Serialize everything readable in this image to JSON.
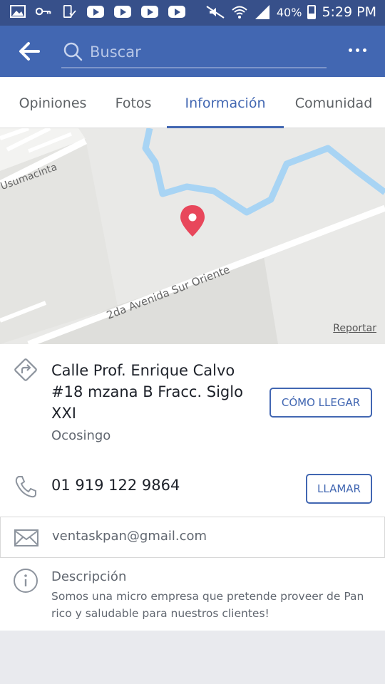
{
  "status_bar": {
    "battery": "40%",
    "time": "5:29 PM"
  },
  "header": {
    "search_placeholder": "Buscar"
  },
  "tabs": [
    {
      "label": "Opiniones",
      "active": false
    },
    {
      "label": "Fotos",
      "active": false
    },
    {
      "label": "Información",
      "active": true
    },
    {
      "label": "Comunidad",
      "active": false
    }
  ],
  "map": {
    "street_1": "Usumacinta",
    "street_2": "2da Avenida Sur Oriente",
    "report_link": "Reportar",
    "pin_color": "#e8475b",
    "river_color": "#a8d4f4"
  },
  "info": {
    "address": "Calle Prof. Enrique Calvo #18 mzana B Fracc. Siglo XXI",
    "city": "Ocosingo",
    "directions_button": "CÓMO LLEGAR",
    "phone": "01 919 122 9864",
    "call_button": "LLAMAR",
    "email": "ventaskpan@gmail.com",
    "description_label": "Descripción",
    "description_text": "Somos una micro empresa que pretende proveer de Pan rico y saludable para nuestros clientes!"
  },
  "colors": {
    "brand": "#4267b2",
    "status_bar": "#37508a"
  }
}
